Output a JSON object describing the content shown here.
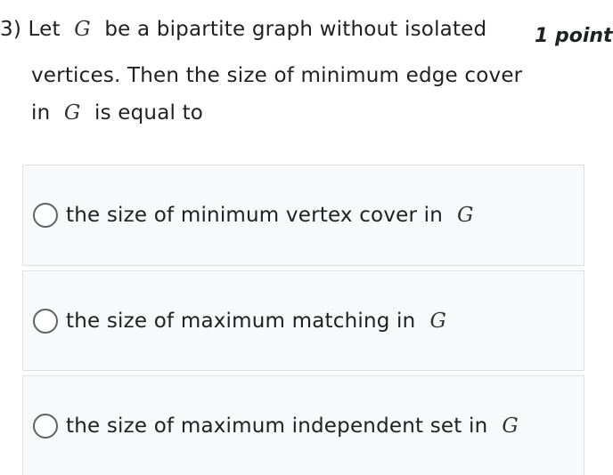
{
  "question": {
    "number": "3)",
    "line1_prefix": "Let",
    "line1_var": "G",
    "line1_suffix": "be a bipartite graph without isolated",
    "line2": "vertices. Then the size of minimum edge cover",
    "line3_prefix": "in",
    "line3_var": "G",
    "line3_suffix": "is equal to",
    "points": "1 point"
  },
  "options": [
    {
      "label": "the size of minimum vertex cover in",
      "var": "G"
    },
    {
      "label": "the size of maximum matching in",
      "var": "G"
    },
    {
      "label": "the size of maximum independent set in",
      "var": "G"
    }
  ]
}
